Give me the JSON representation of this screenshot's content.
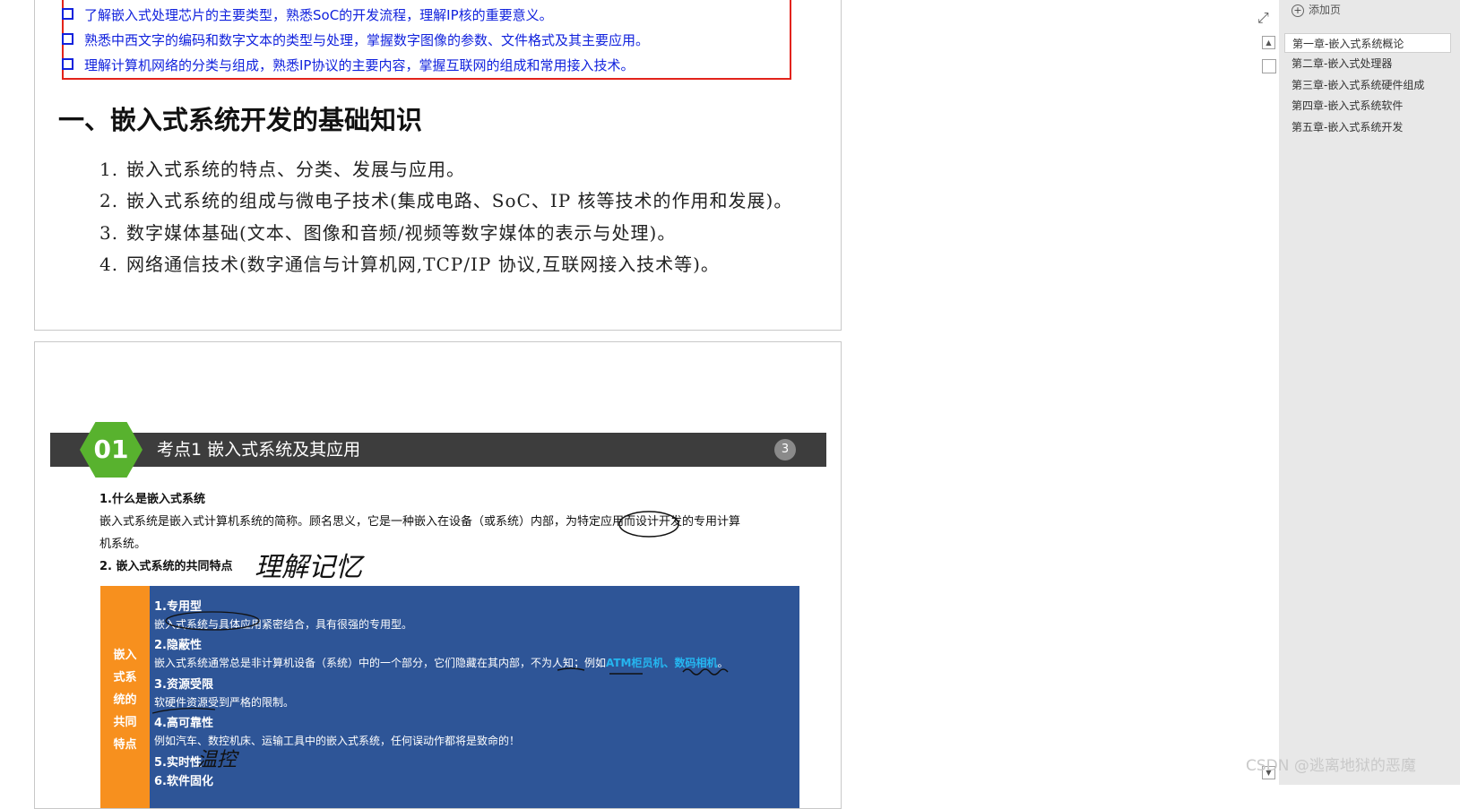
{
  "page1": {
    "objectives": [
      "了解嵌入式处理芯片的主要类型，熟悉SoC的开发流程，理解IP核的重要意义。",
      "熟悉中西文字的编码和数字文本的类型与处理，掌握数字图像的参数、文件格式及其主要应用。",
      "理解计算机网络的分类与组成，熟悉IP协议的主要内容，掌握互联网的组成和常用接入技术。"
    ],
    "section_title": "一、嵌入式系统开发的基础知识",
    "list": [
      {
        "num": "1.",
        "text": "嵌入式系统的特点、分类、发展与应用。"
      },
      {
        "num": "2.",
        "text": "嵌入式系统的组成与微电子技术(集成电路、SoC、IP 核等技术的作用和发展)。"
      },
      {
        "num": "3.",
        "text": "数字媒体基础(文本、图像和音频/视频等数字媒体的表示与处理)。"
      },
      {
        "num": "4.",
        "text": "网络通信技术(数字通信与计算机网,TCP/IP 协议,互联网接入技术等)。"
      }
    ]
  },
  "page2": {
    "badge_number": "01",
    "header_title": "考点1  嵌入式系统及其应用",
    "page_badge": "3",
    "q1_title": "1.什么是嵌入式系统",
    "q1_line1": "嵌入式系统是嵌入式计算机系统的简称。顾名思义，它是一种嵌入在设备（或系统）内部，为特定应用而设计开发的专用计算",
    "q1_line2": "机系统。",
    "q2_title": "2. 嵌入式系统的共同特点",
    "table_label": [
      "嵌入",
      "式系",
      "统的",
      "共同",
      "特点"
    ],
    "rows": {
      "r1_title": "1.专用型",
      "r1_text": "嵌入式系统与具体应用紧密结合，具有很强的专用型。",
      "r2_title": "2.隐蔽性",
      "r2_text": "嵌入式系统通常总是非计算机设备（系统）中的一个部分，它们隐藏在其内部，不为人知；例如",
      "r2_highlight": "ATM柜员机、数码相机",
      "r2_end": "。",
      "r3_title": "3.资源受限",
      "r3_text": "软硬件资源受到严格的限制。",
      "r4_title": "4.高可靠性",
      "r4_text": "例如汽车、数控机床、运输工具中的嵌入式系统，任何误动作都将是致命的！",
      "r5_title": "5.实时性",
      "r6_title": "6.软件固化"
    },
    "handwriting": {
      "note1": "理解记忆",
      "note2": "温控"
    }
  },
  "sidebar": {
    "add_page": "添加页",
    "items": [
      "第一章-嵌入式系统概论",
      "第二章-嵌入式处理器",
      "第三章-嵌入式系统硬件组成",
      "第四章-嵌入式系统软件",
      "第五章-嵌入式系统开发"
    ],
    "selected_index": 0
  },
  "watermark": "CSDN @逃离地狱的恶魔",
  "colors": {
    "objective_text": "#1122dd",
    "objective_border": "#e2231a",
    "header_bar": "#3d3d3d",
    "hex_badge": "#58b22e",
    "table_bg": "#2e5597",
    "table_label_bg": "#f7901e",
    "highlight": "#25b6f0"
  }
}
